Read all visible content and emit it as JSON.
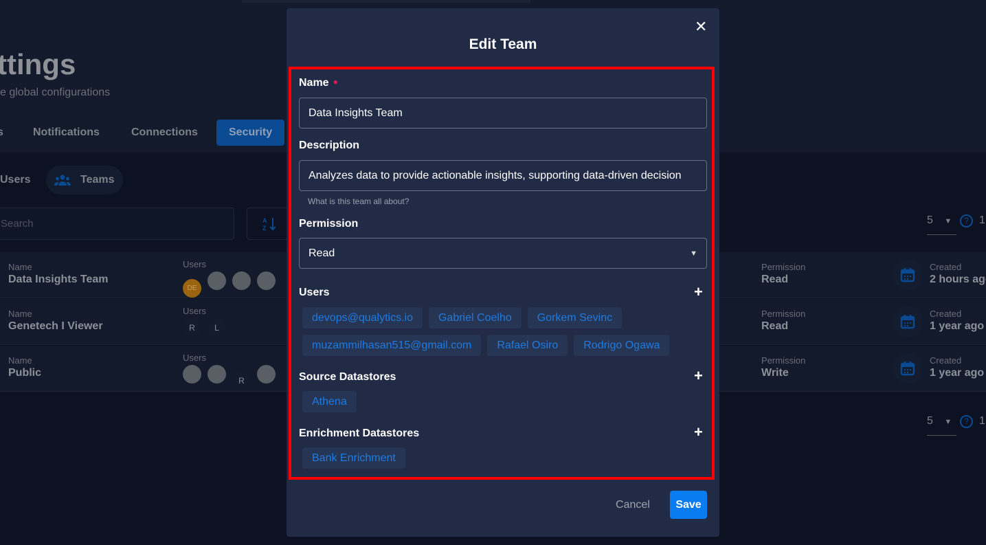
{
  "page": {
    "title": "ttings",
    "subtitle": "e global configurations",
    "tabs": [
      {
        "label": "s"
      },
      {
        "label": "Notifications"
      },
      {
        "label": "Connections"
      },
      {
        "label": "Security",
        "active": true
      }
    ],
    "subtabs": [
      {
        "label": "Users"
      },
      {
        "label": "Teams",
        "active": true
      }
    ],
    "search_placeholder": "Search",
    "page_size": "5",
    "page_size_suffix": "1",
    "rows": [
      {
        "name_label": "Name",
        "name": "Data Insights Team",
        "users_label": "Users",
        "avatars": [
          "DE",
          "photo",
          "photo",
          "photo"
        ],
        "permission_label": "Permission",
        "permission": "Read",
        "created_label": "Created",
        "created": "2 hours ago"
      },
      {
        "name_label": "Name",
        "name": "Genetech I Viewer",
        "users_label": "Users",
        "avatars": [
          "R",
          "L"
        ],
        "permission_label": "Permission",
        "permission": "Read",
        "created_label": "Created",
        "created": "1 year ago"
      },
      {
        "name_label": "Name",
        "name": "Public",
        "users_label": "Users",
        "avatars": [
          "photo",
          "photo",
          "R",
          "photo"
        ],
        "permission_label": "Permission",
        "permission": "Write",
        "created_label": "Created",
        "created": "1 year ago"
      }
    ]
  },
  "modal": {
    "title": "Edit Team",
    "close_icon": "close-icon",
    "name_label": "Name",
    "name_value": "Data Insights Team",
    "description_label": "Description",
    "description_value": "Analyzes data to provide actionable insights, supporting data-driven decision",
    "description_help": "What is this team all about?",
    "permission_label": "Permission",
    "permission_value": "Read",
    "users_label": "Users",
    "users": [
      "devops@qualytics.io",
      "Gabriel Coelho",
      "Gorkem Sevinc",
      "muzammilhasan515@gmail.com",
      "Rafael Osiro",
      "Rodrigo Ogawa"
    ],
    "source_label": "Source Datastores",
    "source": [
      "Athena"
    ],
    "enrichment_label": "Enrichment Datastores",
    "enrichment": [
      "Bank Enrichment"
    ],
    "cancel_label": "Cancel",
    "save_label": "Save"
  },
  "colors": {
    "accent": "#0a7cf2",
    "chip_text": "#1f7ae0",
    "required": "#e8175d",
    "highlight": "#ff0000",
    "modal_bg": "#222b45"
  }
}
